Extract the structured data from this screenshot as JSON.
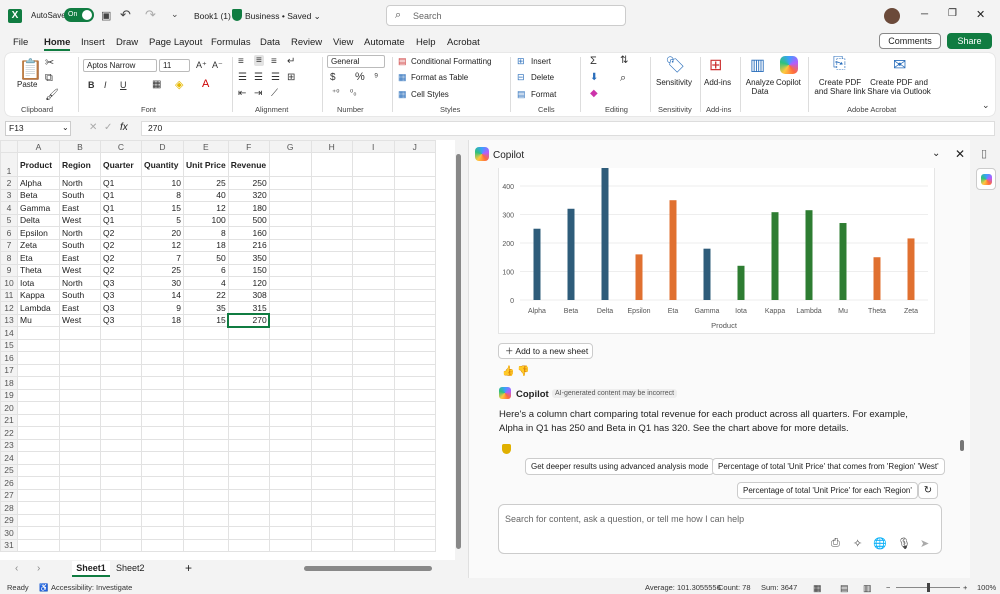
{
  "titlebar": {
    "autosave_label": "AutoSave",
    "autosave_state": "On",
    "doc_title": "Book1 (1)",
    "doc_status": "Business • Saved ⌄",
    "search_placeholder": "Search"
  },
  "menu": {
    "tabs": [
      "File",
      "Home",
      "Insert",
      "Draw",
      "Page Layout",
      "Formulas",
      "Data",
      "Review",
      "View",
      "Automate",
      "Help",
      "Acrobat"
    ],
    "comments": "Comments",
    "share": "Share"
  },
  "ribbon": {
    "paste": "Paste",
    "font_name": "Aptos Narrow",
    "font_size": "11",
    "number_format": "General",
    "conditional_formatting": "Conditional Formatting",
    "format_as_table": "Format as Table",
    "cell_styles": "Cell Styles",
    "insert": "Insert",
    "delete": "Delete",
    "format": "Format",
    "sensitivity": "Sensitivity",
    "addins": "Add-ins",
    "analyze_data": "Analyze Data",
    "copilot": "Copilot",
    "create_pdf_share_link": "Create PDF and Share link",
    "create_pdf_outlook": "Create PDF and Share via Outlook",
    "groups": {
      "clipboard": "Clipboard",
      "font": "Font",
      "alignment": "Alignment",
      "number": "Number",
      "styles": "Styles",
      "cells": "Cells",
      "editing": "Editing",
      "sensitivity": "Sensitivity",
      "addins": "Add-ins",
      "adobe": "Adobe Acrobat"
    }
  },
  "formula_bar": {
    "name_box": "F13",
    "fx": "fx",
    "value": "270"
  },
  "sheet": {
    "columns": [
      "A",
      "B",
      "C",
      "D",
      "E",
      "F",
      "G",
      "H",
      "I",
      "J"
    ],
    "header": [
      "Product",
      "Region",
      "Quarter",
      "Quantity",
      "Unit Price",
      "Revenue"
    ],
    "rows": [
      [
        "Alpha",
        "North",
        "Q1",
        "10",
        "25",
        "250"
      ],
      [
        "Beta",
        "South",
        "Q1",
        "8",
        "40",
        "320"
      ],
      [
        "Gamma",
        "East",
        "Q1",
        "15",
        "12",
        "180"
      ],
      [
        "Delta",
        "West",
        "Q1",
        "5",
        "100",
        "500"
      ],
      [
        "Epsilon",
        "North",
        "Q2",
        "20",
        "8",
        "160"
      ],
      [
        "Zeta",
        "South",
        "Q2",
        "12",
        "18",
        "216"
      ],
      [
        "Eta",
        "East",
        "Q2",
        "7",
        "50",
        "350"
      ],
      [
        "Theta",
        "West",
        "Q2",
        "25",
        "6",
        "150"
      ],
      [
        "Iota",
        "North",
        "Q3",
        "30",
        "4",
        "120"
      ],
      [
        "Kappa",
        "South",
        "Q3",
        "14",
        "22",
        "308"
      ],
      [
        "Lambda",
        "East",
        "Q3",
        "9",
        "35",
        "315"
      ],
      [
        "Mu",
        "West",
        "Q3",
        "18",
        "15",
        "270"
      ]
    ],
    "row_count": 31,
    "tabs": [
      "Sheet1",
      "Sheet2"
    ]
  },
  "copilot": {
    "title": "Copilot",
    "add_to_sheet": "Add to a new sheet",
    "name": "Copilot",
    "ai_badge": "AI-generated content may be incorrect",
    "message": "Here's a column chart comparing total revenue for each product across all quarters. For example, Alpha in Q1 has 250 and Beta in Q1 has 320. See the chart above for more details.",
    "suggestions": [
      "Get deeper results using advanced analysis mode",
      "Percentage of total 'Unit Price' that comes from 'Region' 'West'",
      "Percentage of total 'Unit Price' for each 'Region'"
    ],
    "input_placeholder": "Search for content, ask a question, or tell me how I can help"
  },
  "chart_data": {
    "type": "bar",
    "categories": [
      "Alpha",
      "Beta",
      "Delta",
      "Epsilon",
      "Eta",
      "Gamma",
      "Iota",
      "Kappa",
      "Lambda",
      "Mu",
      "Theta",
      "Zeta"
    ],
    "values": [
      250,
      320,
      500,
      160,
      350,
      180,
      120,
      308,
      315,
      270,
      150,
      216
    ],
    "colors": [
      "#2e5c7a",
      "#2e5c7a",
      "#2e5c7a",
      "#e07030",
      "#e07030",
      "#2e5c7a",
      "#2e7d32",
      "#2e7d32",
      "#2e7d32",
      "#2e7d32",
      "#e07030",
      "#e07030"
    ],
    "yticks": [
      0,
      100,
      200,
      300,
      400
    ],
    "ylim": [
      0,
      470
    ],
    "xlabel": "Product",
    "ylabel": ""
  },
  "status": {
    "ready": "Ready",
    "accessibility": "Accessibility: Investigate",
    "average": "Average: 101.3055556",
    "count": "Count: 78",
    "sum": "Sum: 3647",
    "zoom": "100%"
  }
}
